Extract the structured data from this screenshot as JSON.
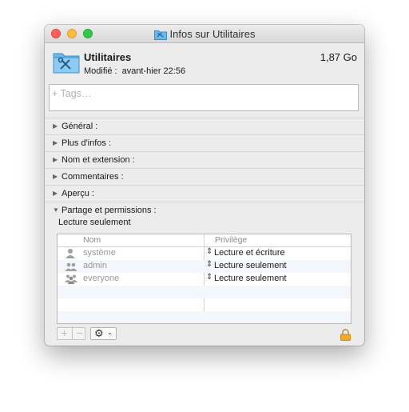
{
  "window": {
    "title": "Infos sur Utilitaires"
  },
  "header": {
    "name": "Utilitaires",
    "size": "1,87 Go",
    "modified_label": "Modifié :",
    "modified_value": "avant-hier 22:56"
  },
  "tags": {
    "placeholder": "+ Tags…"
  },
  "sections": [
    {
      "label": "Général :",
      "expanded": false
    },
    {
      "label": "Plus d'infos :",
      "expanded": false
    },
    {
      "label": "Nom et extension :",
      "expanded": false
    },
    {
      "label": "Commentaires :",
      "expanded": false
    },
    {
      "label": "Aperçu :",
      "expanded": false
    },
    {
      "label": "Partage et permissions :",
      "expanded": true
    }
  ],
  "permissions": {
    "subtitle": "Lecture seulement",
    "columns": [
      "Nom",
      "Privilège"
    ],
    "rows": [
      {
        "name": "système",
        "privilege": "Lecture et écriture",
        "icon": "user-icon"
      },
      {
        "name": "admin",
        "privilege": "Lecture seulement",
        "icon": "group-icon"
      },
      {
        "name": "everyone",
        "privilege": "Lecture seulement",
        "icon": "everyone-icon"
      }
    ]
  },
  "toolbar": {
    "add_label": "+",
    "remove_label": "−"
  },
  "colors": {
    "accent": "#4aa3df",
    "lock": "#f0a830"
  }
}
